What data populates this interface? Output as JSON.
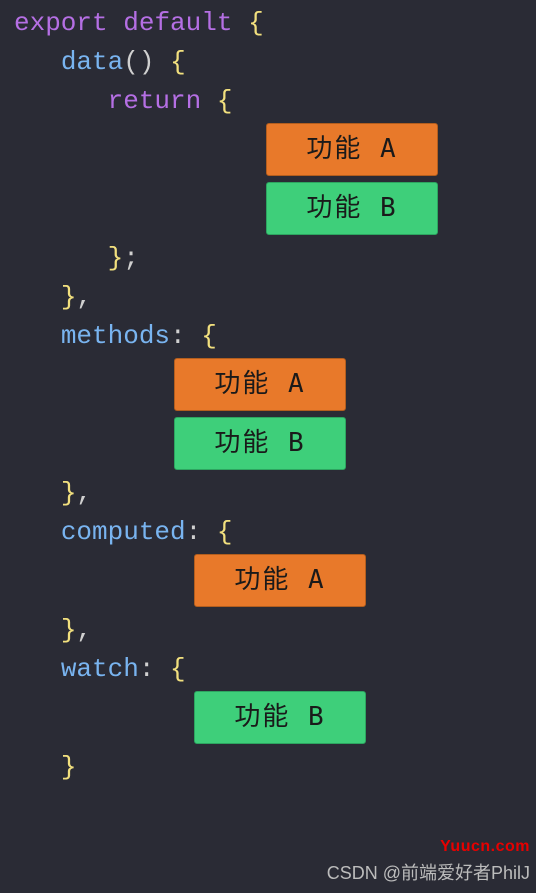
{
  "code": {
    "export": "export",
    "default": "default",
    "data_name": "data",
    "return": "return",
    "methods": "methods",
    "computed": "computed",
    "watch": "watch",
    "open_brace": "{",
    "close_brace": "}",
    "open_paren": "(",
    "close_paren": ")",
    "colon": ":",
    "comma": ",",
    "semicolon": ";"
  },
  "pills": {
    "feature_a": "功能 A",
    "feature_b": "功能 B"
  },
  "colors": {
    "feature_a_bg": "#e8792a",
    "feature_b_bg": "#3ecf7a"
  },
  "watermarks": {
    "site": "Yuucn.com",
    "csdn": "CSDN @前端爱好者PhilJ"
  }
}
